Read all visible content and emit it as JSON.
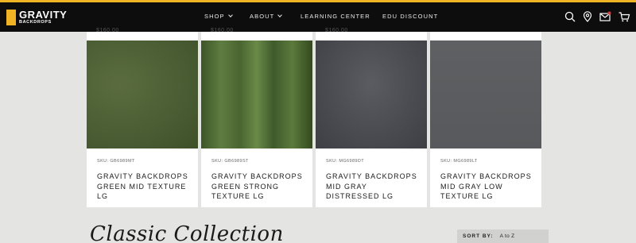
{
  "brand": {
    "name": "GRAVITY",
    "sub": "BACKDROPS",
    "accent_color": "#f0b323",
    "header_bg": "#0d0d0d"
  },
  "nav": {
    "items": [
      {
        "label": "SHOP",
        "has_dropdown": true
      },
      {
        "label": "ABOUT",
        "has_dropdown": true
      },
      {
        "label": "LEARNING CENTER",
        "has_dropdown": false
      },
      {
        "label": "EDU DISCOUNT",
        "has_dropdown": false
      }
    ],
    "icons": [
      "search-icon",
      "location-pin-icon",
      "mail-icon",
      "cart-icon"
    ]
  },
  "products": [
    {
      "price_partial": "$160.00",
      "sku": "SKU: GB6989MT",
      "name": "GRAVITY BACKDROPS GREEN MID TEXTURE LG",
      "swatch_color": "#4f6237"
    },
    {
      "price_partial": "$160.00",
      "sku": "SKU: GB6989ST",
      "name": "GRAVITY BACKDROPS GREEN STRONG TEXTURE LG",
      "swatch_color": "#56743a"
    },
    {
      "price_partial": "$160.00",
      "sku": "SKU: MG6989DT",
      "name": "GRAVITY BACKDROPS MID GRAY DISTRESSED LG",
      "swatch_color": "#4b4d52"
    },
    {
      "price_partial": "",
      "sku": "SKU: MG6989LT",
      "name": "GRAVITY BACKDROPS MID GRAY LOW TEXTURE LG",
      "swatch_color": "#5a5c5f"
    }
  ],
  "collection": {
    "title": "Classic Collection",
    "sort_label": "SORT BY:",
    "sort_value": "A to Z"
  }
}
